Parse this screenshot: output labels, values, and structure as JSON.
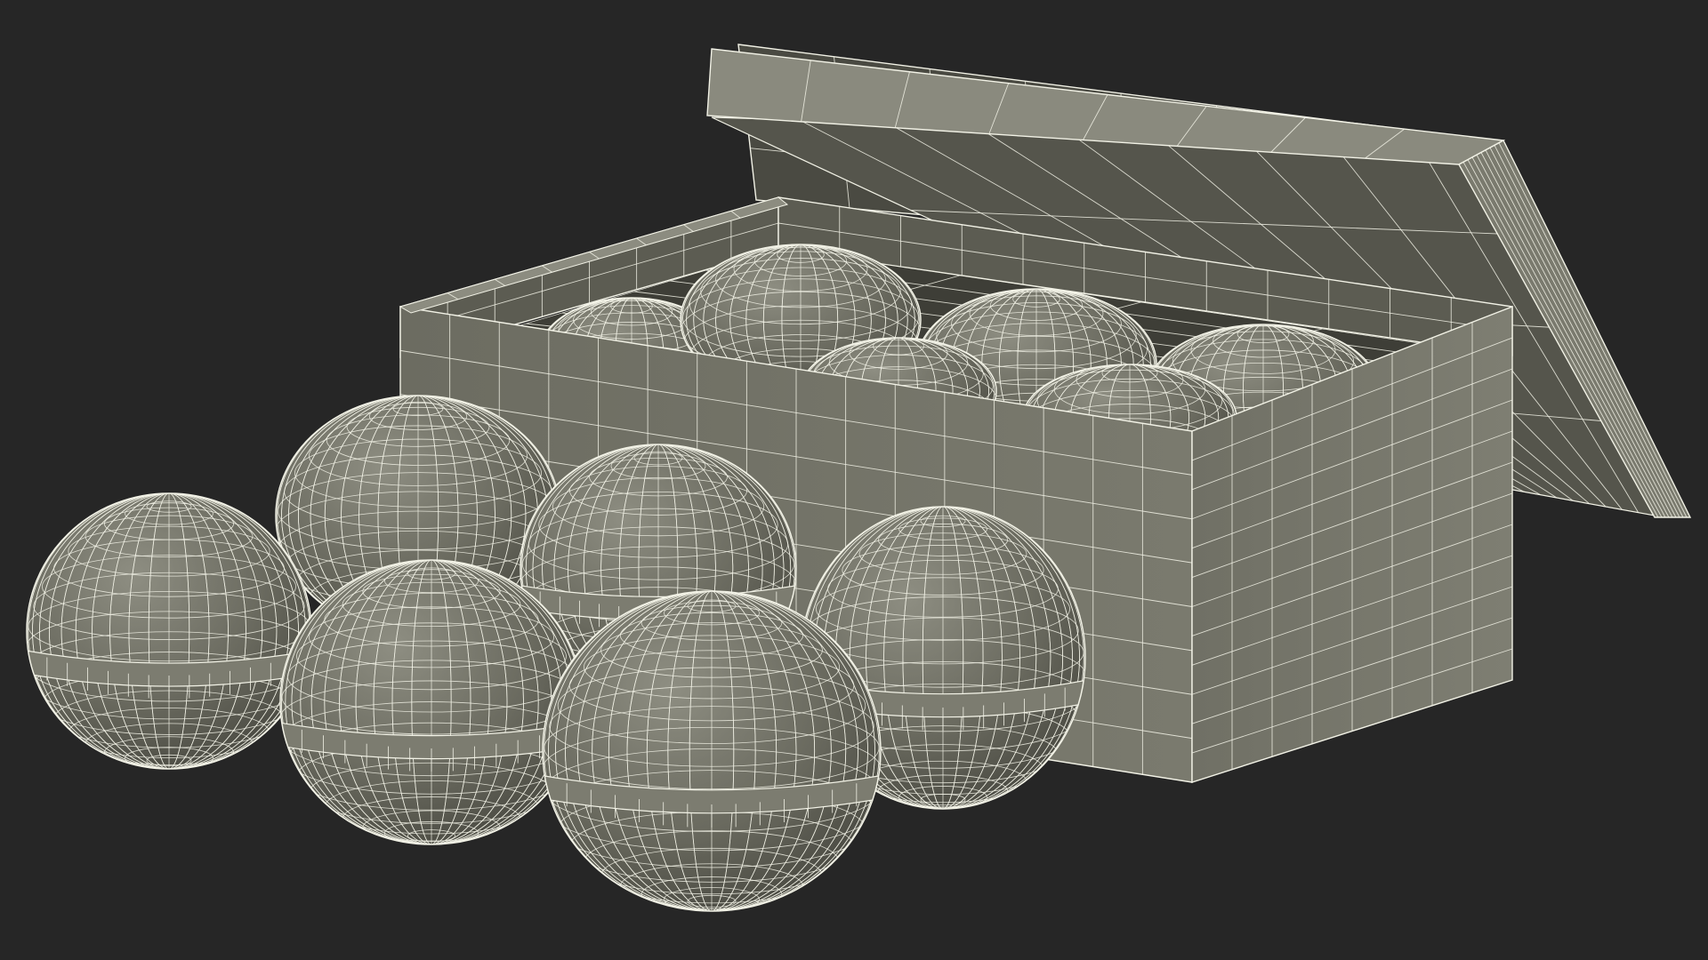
{
  "scene": {
    "background": "#262626",
    "mesh_fill": "#6e6e63",
    "mesh_fill_light": "#8a8a7e",
    "mesh_fill_dark": "#4f4f46",
    "wire_color": "#f2f2e6",
    "inner_wall": "#5c5c52"
  }
}
